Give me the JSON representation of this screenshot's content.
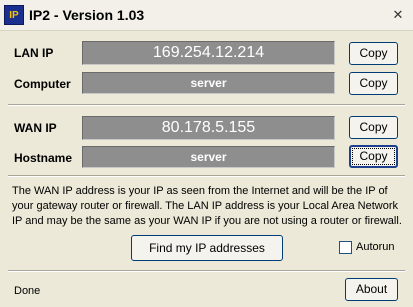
{
  "window": {
    "title": "IP2 - Version 1.03",
    "icon_text": "IP",
    "close_glyph": "✕"
  },
  "lan": {
    "ip_label": "LAN IP",
    "ip_value": "169.254.12.214",
    "computer_label": "Computer",
    "computer_value": "server"
  },
  "wan": {
    "ip_label": "WAN IP",
    "ip_value": "80.178.5.155",
    "hostname_label": "Hostname",
    "hostname_value": "server"
  },
  "buttons": {
    "copy": "Copy",
    "find": "Find my IP addresses",
    "about": "About"
  },
  "info_text": "The WAN IP address is your IP as seen from the Internet and will be the IP of your gateway router or firewall. The LAN IP address is your Local Area Network IP and may be the same as your WAN IP if you are not using a router or firewall.",
  "autorun": {
    "label": "Autorun",
    "checked": false
  },
  "status": "Done",
  "colors": {
    "field_bg": "#8e8e8e",
    "window_bg": "#ece9d8",
    "icon_bg": "#1b2f8f",
    "icon_fg": "#f5c400"
  }
}
